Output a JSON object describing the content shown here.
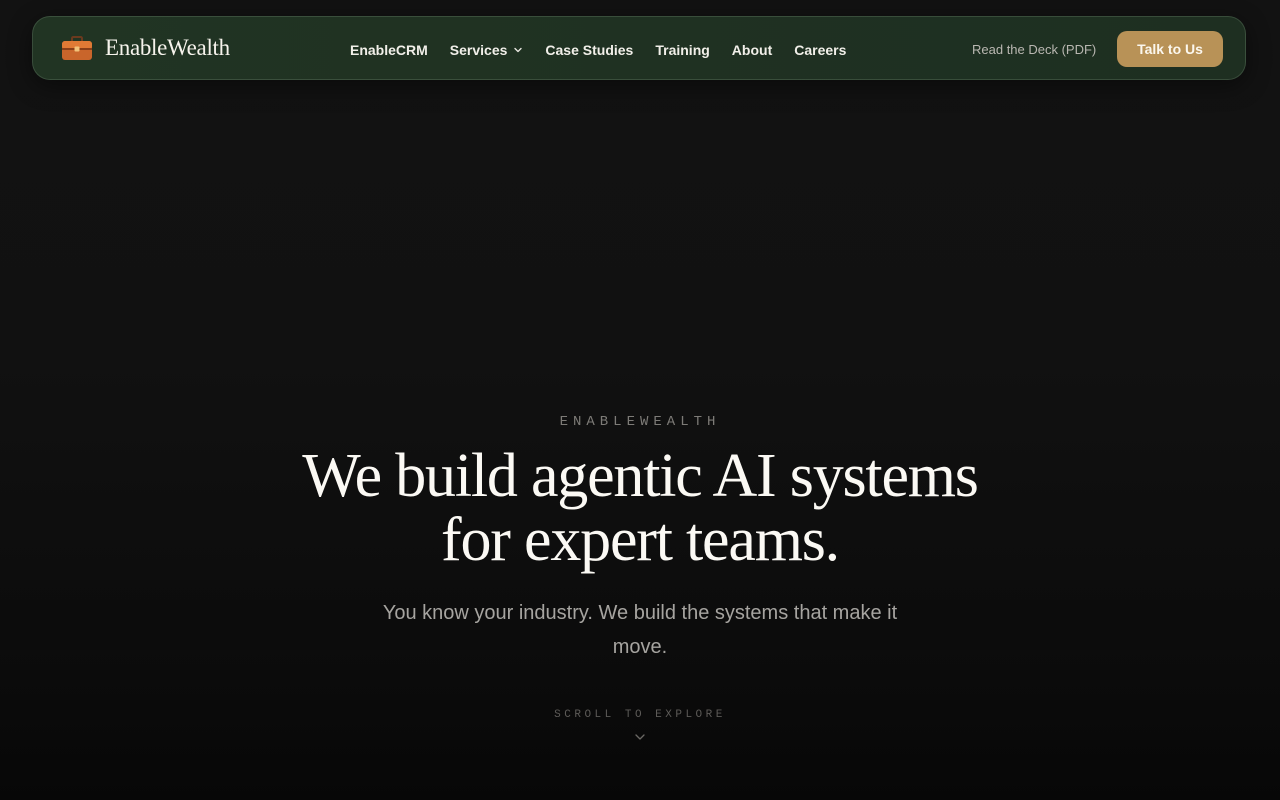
{
  "brand": {
    "name": "EnableWealth",
    "icon": "briefcase-icon"
  },
  "nav": {
    "links": [
      {
        "label": "EnableCRM"
      },
      {
        "label": "Services",
        "has_dropdown": true
      },
      {
        "label": "Case Studies"
      },
      {
        "label": "Training"
      },
      {
        "label": "About"
      },
      {
        "label": "Careers"
      }
    ],
    "deck_label": "Read the Deck (PDF)",
    "cta_label": "Talk to Us"
  },
  "hero": {
    "eyebrow": "ENABLEWEALTH",
    "headline_line1": "We build agentic AI systems",
    "headline_line2": "for expert teams.",
    "subhead": "You know your industry. We build the systems that make it move.",
    "scroll_label": "SCROLL TO EXPLORE"
  },
  "colors": {
    "nav_background": "#213423",
    "cta_background": "#b89257",
    "page_background": "#111111",
    "headline_text": "#fbf9f4",
    "subhead_text": "#a6a4a0"
  }
}
